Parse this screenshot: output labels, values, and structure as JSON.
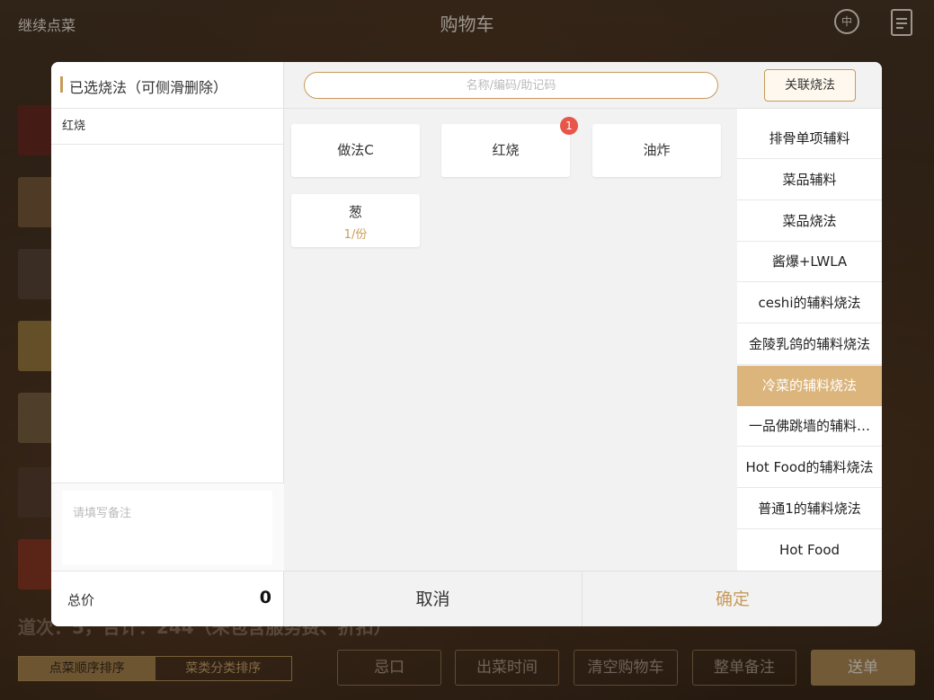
{
  "topbar": {
    "back_label": "继续点菜",
    "title": "购物车",
    "lang_icon_glyph": "中"
  },
  "summary_text": "道次：5，合计：244（未包含服务费、折扣）",
  "bottombar": {
    "sort_tabs": [
      "点菜顺序排序",
      "菜类分类排序"
    ],
    "buttons": {
      "avoid": "忌口",
      "serve_time": "出菜时间",
      "clear_cart": "清空购物车",
      "whole_note": "整单备注",
      "send": "送单"
    }
  },
  "modal": {
    "left_title": "已选烧法（可侧滑删除）",
    "selected": [
      "红烧"
    ],
    "remark_placeholder": "请填写备注",
    "total_label": "总价",
    "total_value": "0",
    "search_placeholder": "名称/编码/助记码",
    "assoc_button": "关联烧法",
    "methods": [
      {
        "name": "做法C",
        "sub": ""
      },
      {
        "name": "红烧",
        "sub": "",
        "badge": "1"
      },
      {
        "name": "油炸",
        "sub": ""
      },
      {
        "name": "葱",
        "sub": "1/份"
      }
    ],
    "categories": [
      "排骨单项辅料",
      "菜品辅料",
      "菜品烧法",
      "酱爆+LWLA",
      "ceshi的辅料烧法",
      "金陵乳鸽的辅料烧法",
      "冷菜的辅料烧法",
      "一品佛跳墙的辅料…",
      "Hot Food的辅料烧法",
      "普通1的辅料烧法",
      "Hot Food"
    ],
    "active_category": "冷菜的辅料烧法",
    "cancel_label": "取消",
    "confirm_label": "确定"
  },
  "colors": {
    "accent": "#c89a5a",
    "active_category_bg": "#dbb57c",
    "badge": "#e8564a"
  }
}
